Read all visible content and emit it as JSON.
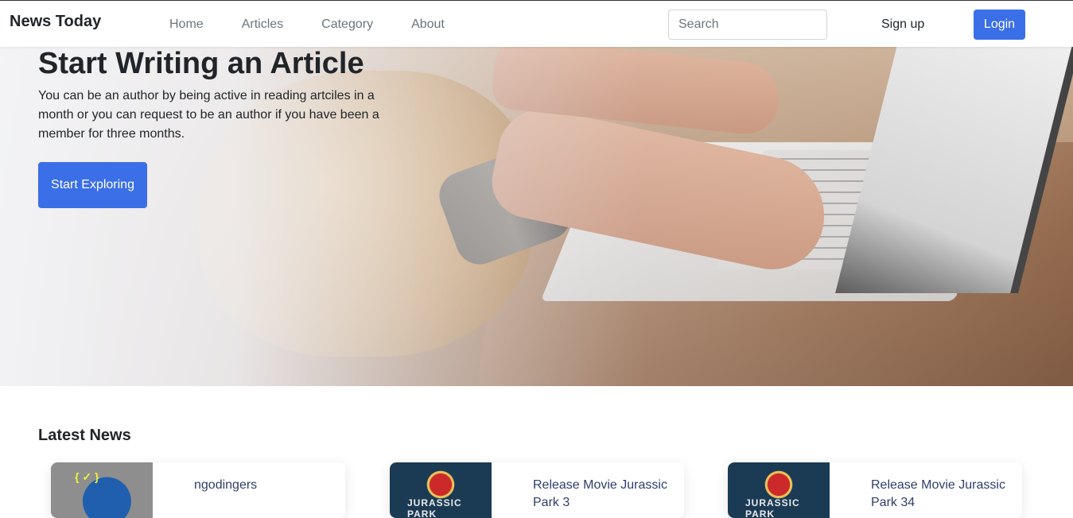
{
  "navbar": {
    "brand": "News Today",
    "links": [
      "Home",
      "Articles",
      "Category",
      "About"
    ],
    "search_placeholder": "Search",
    "signup_label": "Sign up",
    "login_label": "Login",
    "accent_color": "#3a6fe8"
  },
  "hero": {
    "title": "Start Writing an Article",
    "description": "You can be an author by being active in reading artciles in a month or you can request to be an author if you have been a member for three months.",
    "button_label": "Start Exploring",
    "image": "hands-typing-on-laptop"
  },
  "latest": {
    "title": "Latest News",
    "cards": [
      {
        "title": "ngodingers",
        "thumb_text": "{ ✓ }"
      },
      {
        "title": "Release Movie Jurassic Park 3",
        "thumb_text": "JURASSIC PARK"
      },
      {
        "title": "Release Movie Jurassic Park 34",
        "thumb_text": "JURASSIC PARK"
      }
    ]
  }
}
